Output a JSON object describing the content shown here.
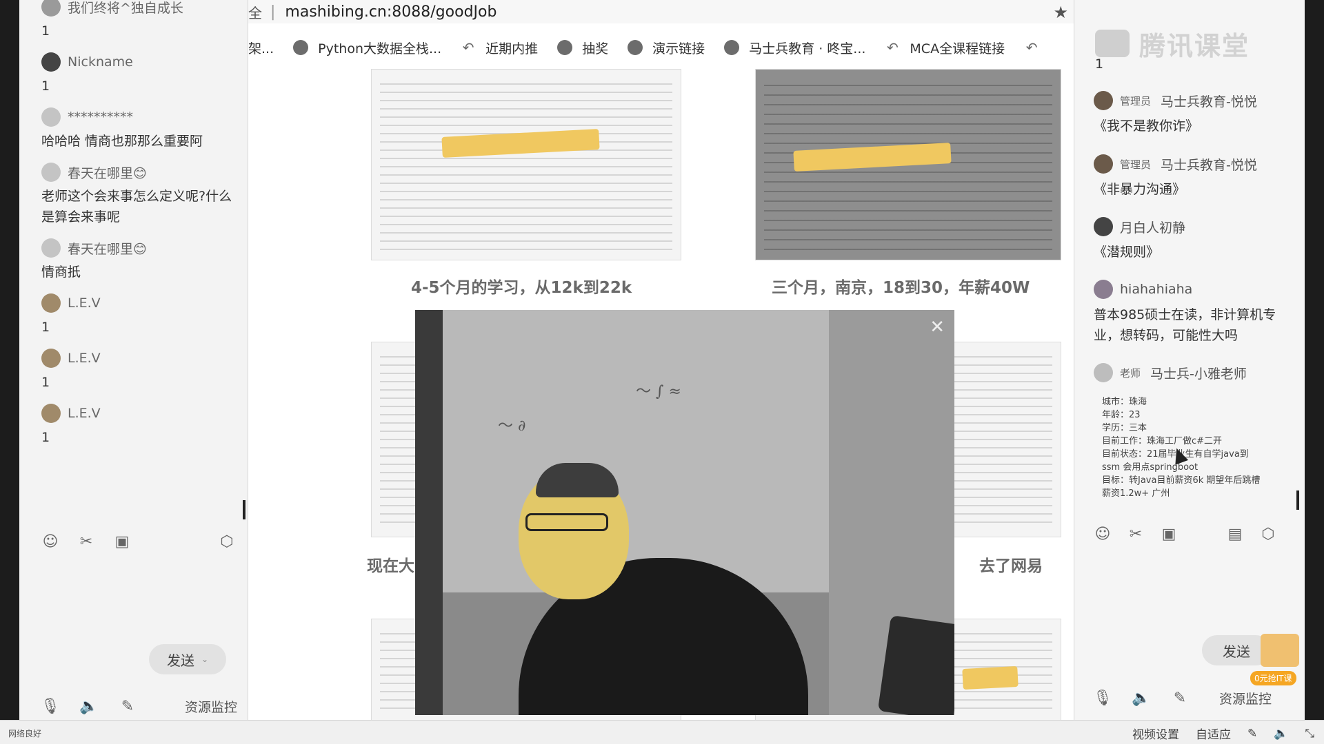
{
  "left_chat": {
    "messages": [
      {
        "name": "我们终将^独自成长",
        "text": "1"
      },
      {
        "name": "Nickname",
        "text": "1"
      },
      {
        "name": "**********",
        "text": "哈哈哈 情商也那那么重要阿"
      },
      {
        "name": "春天在哪里😊",
        "text": "老师这个会来事怎么定义呢?什么是算会来事呢"
      },
      {
        "name": "春天在哪里😊",
        "text": "情商扺"
      },
      {
        "name": "L.E.V",
        "text": "1"
      },
      {
        "name": "L.E.V",
        "text": "1"
      },
      {
        "name": "L.E.V",
        "text": "1"
      }
    ],
    "send_label": "发送",
    "resource_monitor": "资源监控"
  },
  "browser": {
    "url_prefix": "全",
    "url": "mashibing.cn:8088/goodJob",
    "bookmarks": [
      {
        "label": "架...",
        "icon": "cube-icon"
      },
      {
        "label": "Python大数据全栈...",
        "icon": "cube-icon"
      },
      {
        "label": "近期内推",
        "icon": "arrow-icon"
      },
      {
        "label": "抽奖",
        "icon": "circle-icon"
      },
      {
        "label": "演示链接",
        "icon": "circle-icon"
      },
      {
        "label": "马士兵教育 · 咚宝...",
        "icon": "circle-icon"
      },
      {
        "label": "MCA全课程链接",
        "icon": "arrow-icon"
      }
    ],
    "cards": [
      {
        "caption": "4-5个月的学习，从12k到22k"
      },
      {
        "caption": "三个月，南京，18到30，年薪40W"
      },
      {
        "caption": "现在大"
      },
      {
        "caption": "去了网易"
      }
    ]
  },
  "right_chat": {
    "logo_text": "腾讯课堂",
    "first_text": "1",
    "messages": [
      {
        "role": "管理员",
        "name": "马士兵教育-悦悦",
        "text": "《我不是教你诈》"
      },
      {
        "role": "管理员",
        "name": "马士兵教育-悦悦",
        "text": "《非暴力沟通》"
      },
      {
        "role": "",
        "name": "月白人初静",
        "text": "《潜规则》"
      },
      {
        "role": "",
        "name": "hiahahiaha",
        "text": "普本985硕士在读，非计算机专业，想转码，可能性大吗"
      },
      {
        "role": "老师",
        "name": "马士兵-小雅老师",
        "text": ""
      }
    ],
    "detail_lines": [
      "城市：珠海",
      "年龄：23",
      "学历：三本",
      "目前工作：珠海工厂做c#二开",
      "目前状态：21届毕业生有自学java到",
      "ssm 会用点springboot",
      "目标：转Java目前薪资6k 期望年后跳槽",
      "薪资1.2w+ 广州"
    ],
    "send_label": "发送",
    "promo_badge": "0元抢IT课",
    "resource_monitor": "资源监控"
  },
  "status_bar": {
    "network": "网络良好",
    "video_settings": "视频设置",
    "adaptive": "自适应"
  }
}
